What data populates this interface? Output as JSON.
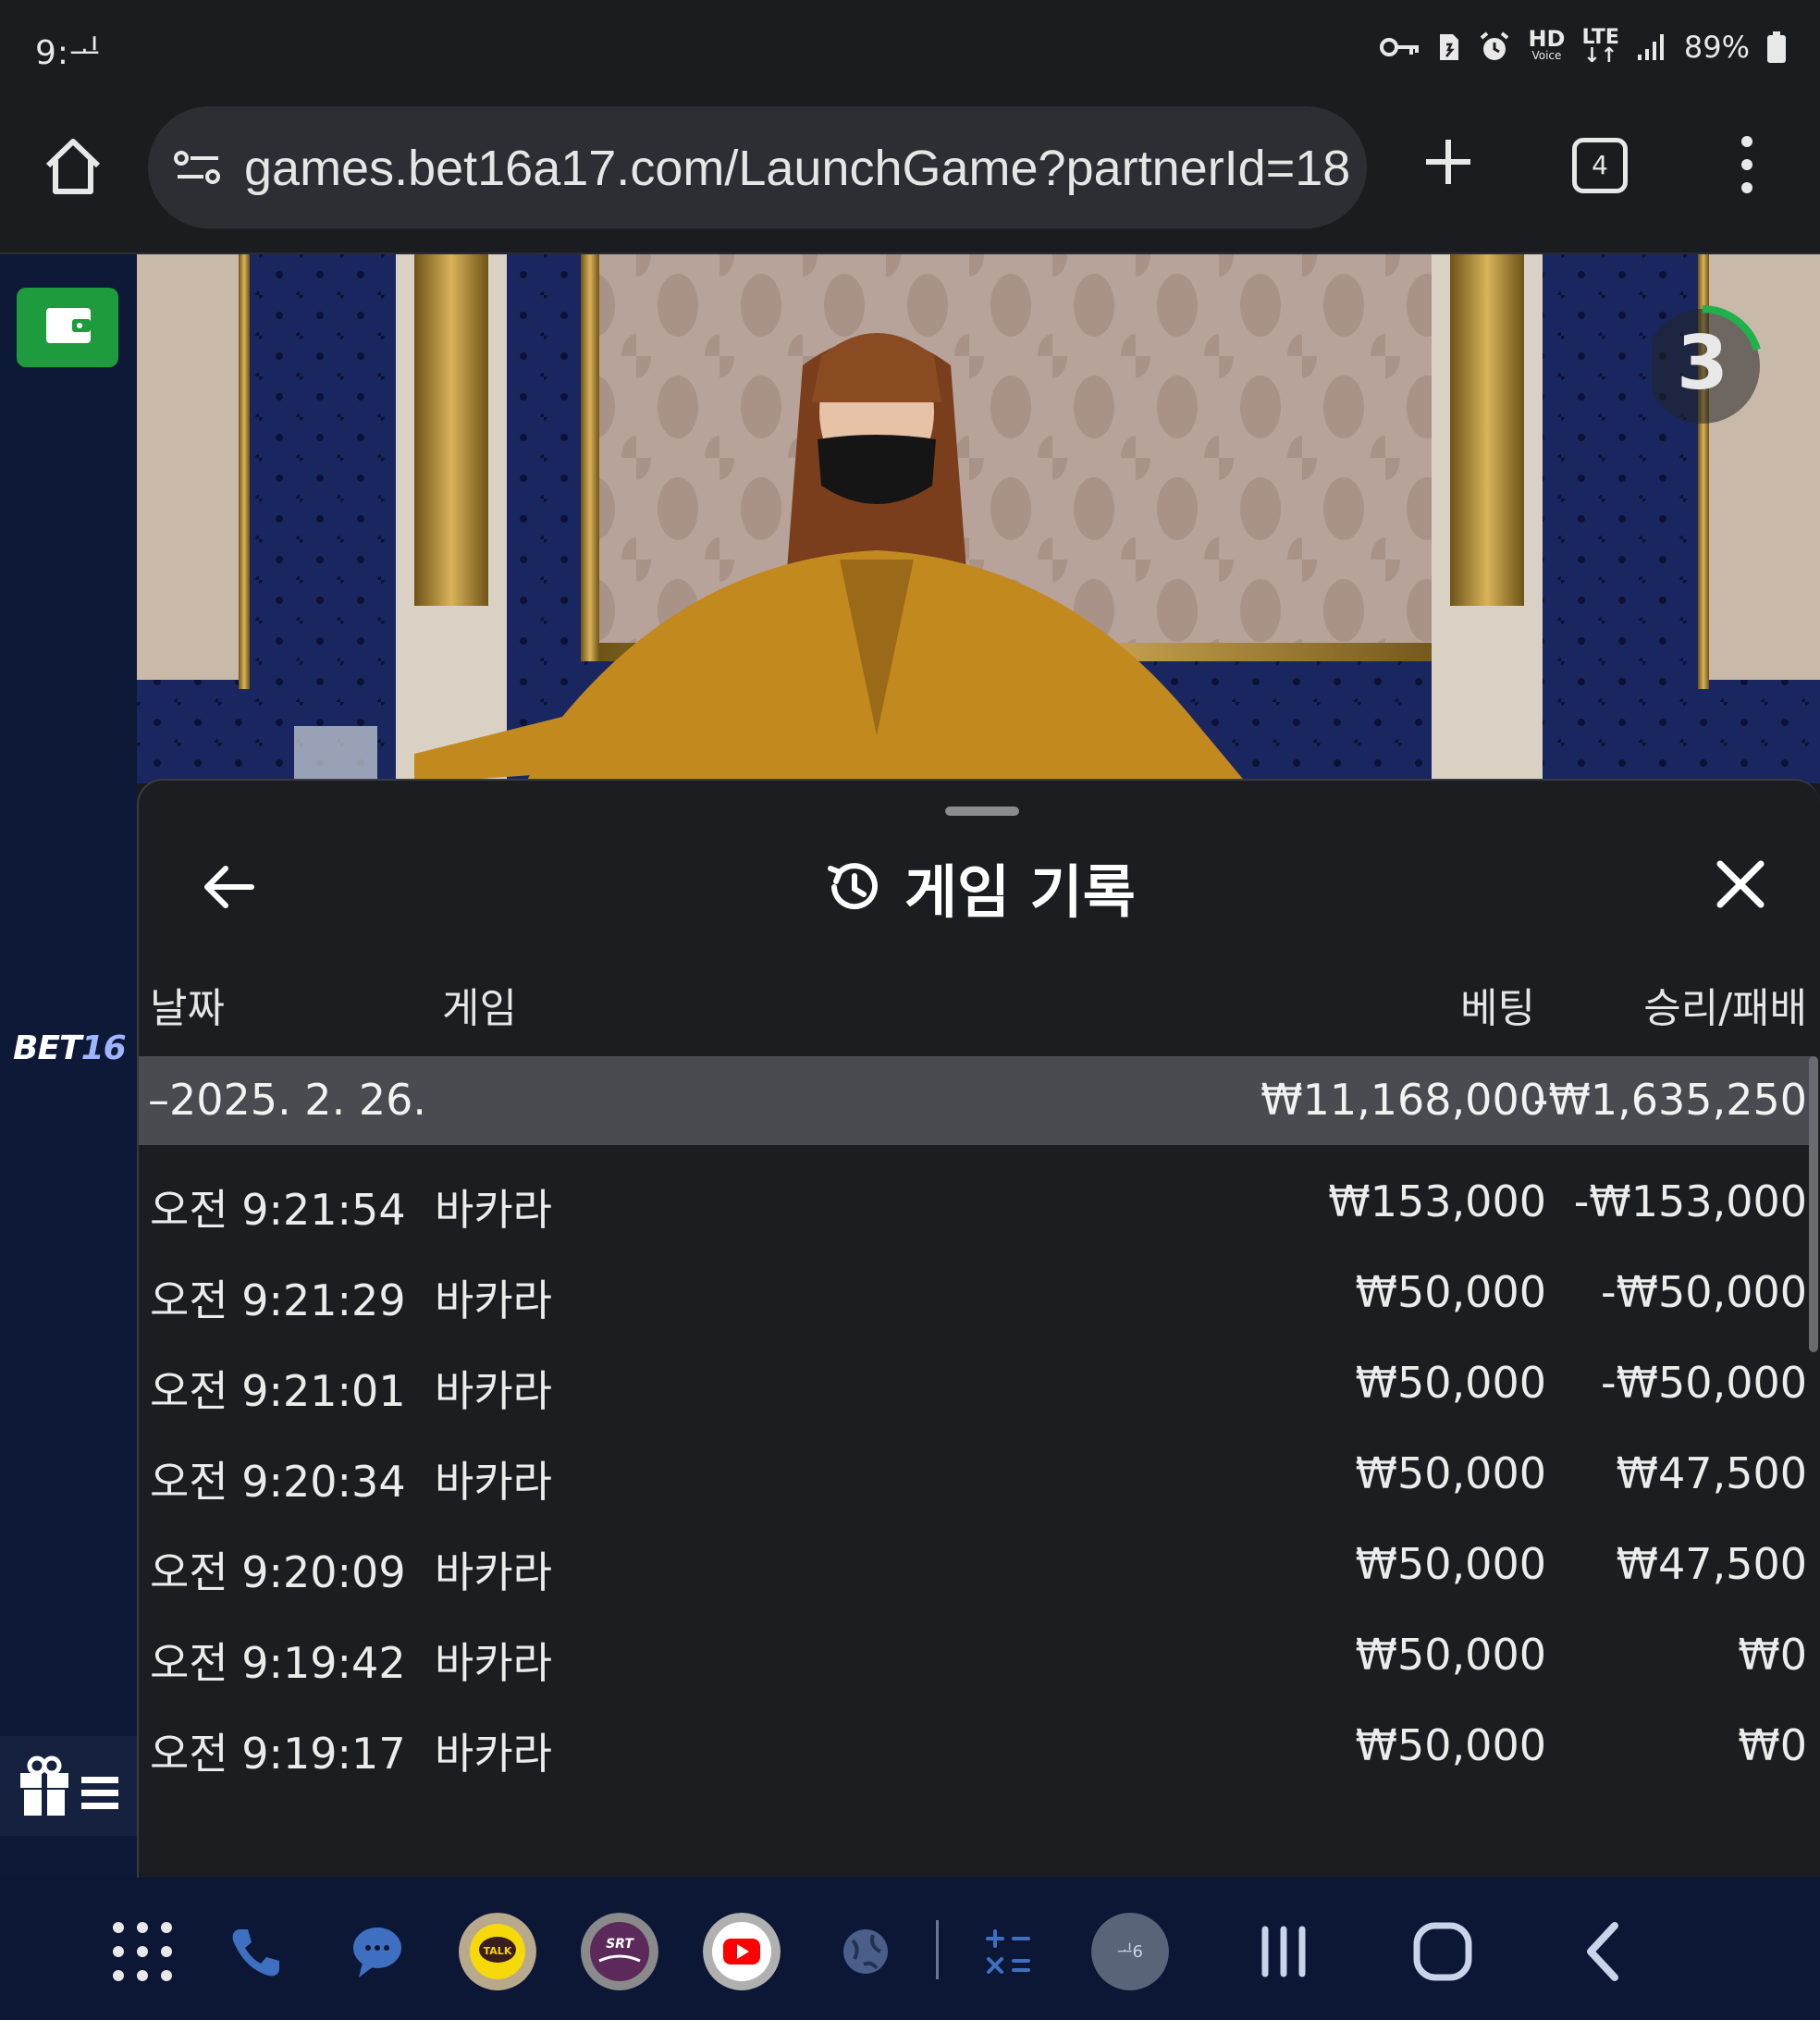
{
  "status_bar": {
    "time": "9:ᆚ",
    "hd_label": "HD",
    "hd_sub": "Voice",
    "lte_label": "LTE",
    "battery": "89%"
  },
  "browser": {
    "url": "games.bet16a17.com/LaunchGame?partnerId=18",
    "tab_count": "4"
  },
  "sidebar": {
    "brand_prefix": "BET",
    "brand_number": "16"
  },
  "video": {
    "countdown": "3",
    "accent_color": "#1fb14b"
  },
  "panel": {
    "title": "게임 기록",
    "columns": {
      "date": "날짜",
      "game": "게임",
      "bet": "베팅",
      "win_loss": "승리/패배"
    },
    "group": {
      "date": "–2025. 2. 26.",
      "bet_total": "₩11,168,000",
      "win_loss_total": "-₩1,635,250"
    },
    "rows": [
      {
        "time": "오전 9:21:54",
        "game": "바카라",
        "bet": "₩153,000",
        "win_loss": "-₩153,000"
      },
      {
        "time": "오전 9:21:29",
        "game": "바카라",
        "bet": "₩50,000",
        "win_loss": "-₩50,000"
      },
      {
        "time": "오전 9:21:01",
        "game": "바카라",
        "bet": "₩50,000",
        "win_loss": "-₩50,000"
      },
      {
        "time": "오전 9:20:34",
        "game": "바카라",
        "bet": "₩50,000",
        "win_loss": "₩47,500"
      },
      {
        "time": "오전 9:20:09",
        "game": "바카라",
        "bet": "₩50,000",
        "win_loss": "₩47,500"
      },
      {
        "time": "오전 9:19:42",
        "game": "바카라",
        "bet": "₩50,000",
        "win_loss": "₩0"
      },
      {
        "time": "오전 9:19:17",
        "game": "바카라",
        "bet": "₩50,000",
        "win_loss": "₩0"
      }
    ]
  },
  "nav": {
    "talk_label": "TALK",
    "srt_label": "SRT",
    "clock_app_label": "ᆚ6"
  }
}
